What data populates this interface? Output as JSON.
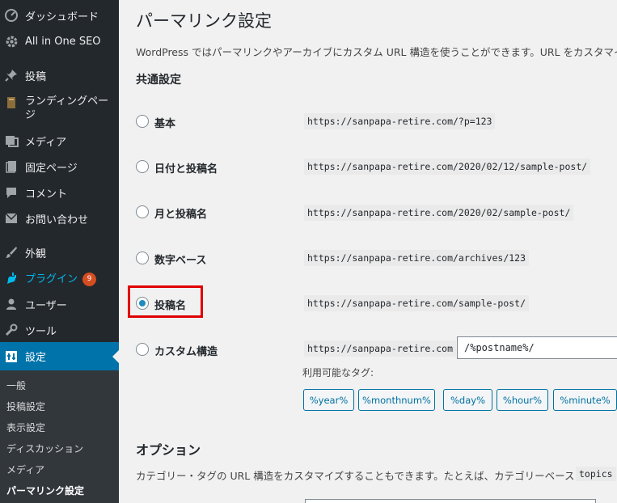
{
  "sidebar": {
    "menu": [
      {
        "label": "ダッシュボード",
        "icon": "dashboard-icon"
      },
      {
        "label": "All in One SEO",
        "icon": "gear-icon"
      },
      {
        "label": "投稿",
        "icon": "pin-icon"
      },
      {
        "label": "ランディングページ",
        "icon": "document-icon"
      },
      {
        "label": "メディア",
        "icon": "media-icon"
      },
      {
        "label": "固定ページ",
        "icon": "page-icon"
      },
      {
        "label": "コメント",
        "icon": "comment-icon"
      },
      {
        "label": "お問い合わせ",
        "icon": "mail-icon"
      },
      {
        "label": "外観",
        "icon": "brush-icon"
      },
      {
        "label": "プラグイン",
        "icon": "plugin-icon",
        "badge": "9"
      },
      {
        "label": "ユーザー",
        "icon": "user-icon"
      },
      {
        "label": "ツール",
        "icon": "wrench-icon"
      },
      {
        "label": "設定",
        "icon": "settings-icon"
      }
    ],
    "submenu": [
      "一般",
      "投稿設定",
      "表示設定",
      "ディスカッション",
      "メディア",
      "パーマリンク設定"
    ]
  },
  "main": {
    "title": "パーマリンク設定",
    "description": "WordPress ではパーマリンクやアーカイブにカスタム URL 構造を使うことができます。URL をカスタマイズす",
    "common_settings_title": "共通設定",
    "options": [
      {
        "label": "基本",
        "url": "https://sanpapa-retire.com/?p=123",
        "checked": false
      },
      {
        "label": "日付と投稿名",
        "url": "https://sanpapa-retire.com/2020/02/12/sample-post/",
        "checked": false
      },
      {
        "label": "月と投稿名",
        "url": "https://sanpapa-retire.com/2020/02/sample-post/",
        "checked": false
      },
      {
        "label": "数字ベース",
        "url": "https://sanpapa-retire.com/archives/123",
        "checked": false
      },
      {
        "label": "投稿名",
        "url": "https://sanpapa-retire.com/sample-post/",
        "checked": true
      },
      {
        "label": "カスタム構造",
        "url": "https://sanpapa-retire.com",
        "checked": false
      }
    ],
    "custom_structure_value": "/%postname%/",
    "available_tags_label": "利用可能なタグ:",
    "tags": [
      "%year%",
      "%monthnum%",
      "%day%",
      "%hour%",
      "%minute%"
    ],
    "options_section_title": "オプション",
    "options_description": "カテゴリー・タグの URL 構造をカスタマイズすることもできます。たとえば、カテゴリーベースに",
    "options_code": "topics"
  },
  "colors": {
    "sidebar_bg": "#23282d",
    "active_menu": "#0073aa",
    "plugins_text": "#00b9eb",
    "badge": "#d54e21",
    "highlight_border": "#e00000"
  }
}
